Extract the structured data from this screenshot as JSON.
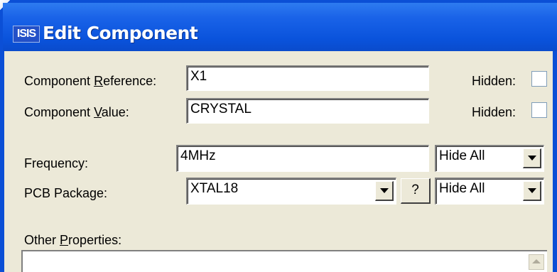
{
  "window": {
    "icon_text": "ISIS",
    "title": "Edit Component"
  },
  "fields": {
    "component_reference": {
      "label_pre": "Component ",
      "label_u": "R",
      "label_post": "eference:",
      "value": "X1",
      "hidden_label": "Hidden:"
    },
    "component_value": {
      "label_pre": "Component ",
      "label_u": "V",
      "label_post": "alue:",
      "value": "CRYSTAL",
      "hidden_label": "Hidden:"
    },
    "frequency": {
      "label": "Frequency:",
      "value": "4MHz",
      "visibility": "Hide All"
    },
    "pcb_package": {
      "label": "PCB Package:",
      "value": "XTAL18",
      "help_label": "?",
      "visibility": "Hide All"
    },
    "other_properties": {
      "label_pre": "Other ",
      "label_u": "P",
      "label_post": "roperties:"
    }
  }
}
